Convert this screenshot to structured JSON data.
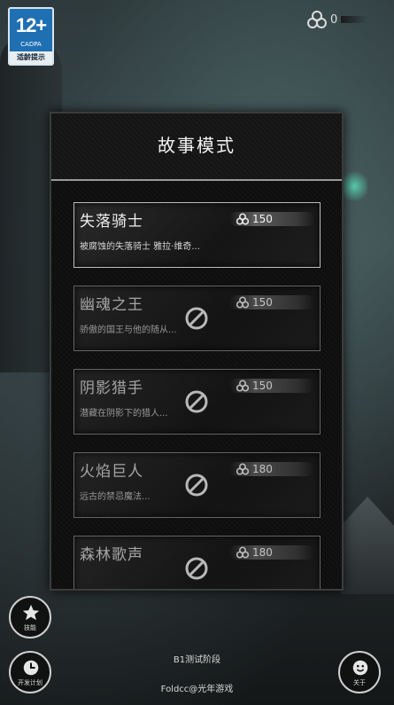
{
  "age_badge": {
    "rating": "12+",
    "org": "CADPA",
    "tip": "适龄提示"
  },
  "currency": {
    "count": "0"
  },
  "panel": {
    "title": "故事模式",
    "stories": [
      {
        "title": "失落骑士",
        "desc": "被腐蚀的失落骑士 雅拉·维奇...",
        "cost": "150",
        "locked": false
      },
      {
        "title": "幽魂之王",
        "desc": "骄傲的国王与他的随从...",
        "cost": "150",
        "locked": true
      },
      {
        "title": "阴影猎手",
        "desc": "潜藏在阴影下的猎人...",
        "cost": "150",
        "locked": true
      },
      {
        "title": "火焰巨人",
        "desc": "远古的禁忌魔法...",
        "cost": "180",
        "locked": true
      },
      {
        "title": "森林歌声",
        "desc": "",
        "cost": "180",
        "locked": true
      }
    ]
  },
  "buttons": {
    "achievements": "技能",
    "dev_plan": "开发计划",
    "about": "关于"
  },
  "footer": {
    "stage": "B1测试阶段",
    "credit": "Foldcc@光年游戏"
  },
  "icons": {
    "currency": "triple-circle-icon",
    "lock": "lock-prohibit-icon",
    "star": "star-icon",
    "clock": "clock-icon",
    "smiley": "smiley-icon"
  }
}
